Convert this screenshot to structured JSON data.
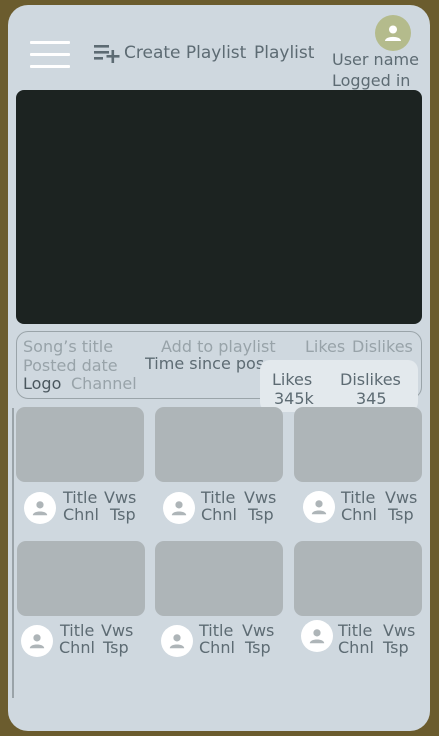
{
  "header": {
    "create_playlist": "Create Playlist",
    "playlist": "Playlist",
    "user_line1": "User name",
    "user_line2": "Logged in"
  },
  "info": {
    "song_title": "Song’s title",
    "add_to_playlist": "Add to playlist",
    "likes": "Likes",
    "dislikes": "Dislikes",
    "posted_date": "Posted date",
    "time_since": "Time since posted",
    "logo": "Logo",
    "channel": "Channel"
  },
  "popup": {
    "likes_label": "Likes",
    "dislikes_label": "Dislikes",
    "likes_value": "345k",
    "dislikes_value": "345"
  },
  "cards": [
    {
      "title": "Title",
      "views": "Vws",
      "channel": "Chnl",
      "timestamp": "Tsp"
    },
    {
      "title": "Title",
      "views": "Vws",
      "channel": "Chnl",
      "timestamp": "Tsp"
    },
    {
      "title": "Title",
      "views": "Vws",
      "channel": "Chnl",
      "timestamp": "Tsp"
    },
    {
      "title": "Title",
      "views": "Vws",
      "channel": "Chnl",
      "timestamp": "Tsp"
    },
    {
      "title": "Title",
      "views": "Vws",
      "channel": "Chnl",
      "timestamp": "Tsp"
    },
    {
      "title": "Title",
      "views": "Vws",
      "channel": "Chnl",
      "timestamp": "Tsp"
    }
  ],
  "icons": {
    "menu": "hamburger-menu-icon",
    "create_playlist": "playlist-add-icon",
    "avatar": "person-icon"
  },
  "colors": {
    "frame": "#6b5c2e",
    "screen": "#cfd8df",
    "video": "#1c2321",
    "thumbnail": "#aeb5b8",
    "avatar_top": "#b4bb8c",
    "text": "#5d6b73",
    "muted_text": "#98a3a9"
  }
}
